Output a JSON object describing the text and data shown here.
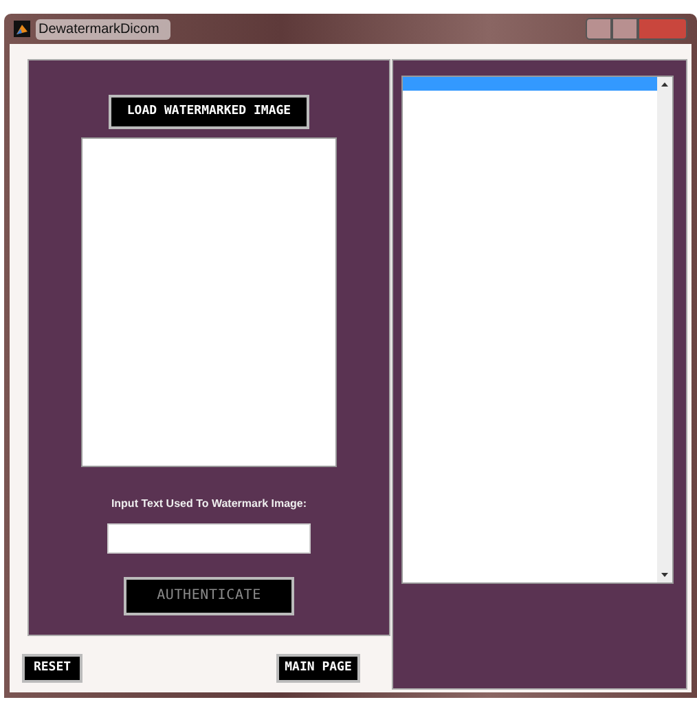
{
  "window": {
    "title": "DewatermarkDicom"
  },
  "load_button": "LOAD WATERMARKED IMAGE",
  "image_area": {
    "kind": "empty"
  },
  "input_label": "Input Text Used To Watermark Image:",
  "authenticate_button": {
    "label": "AUTHENTICATE",
    "disabled": true
  },
  "reset_button": "RESET",
  "main_page_button": "MAIN PAGE",
  "listbox": {
    "rows": [
      {
        "selected": true
      }
    ]
  }
}
